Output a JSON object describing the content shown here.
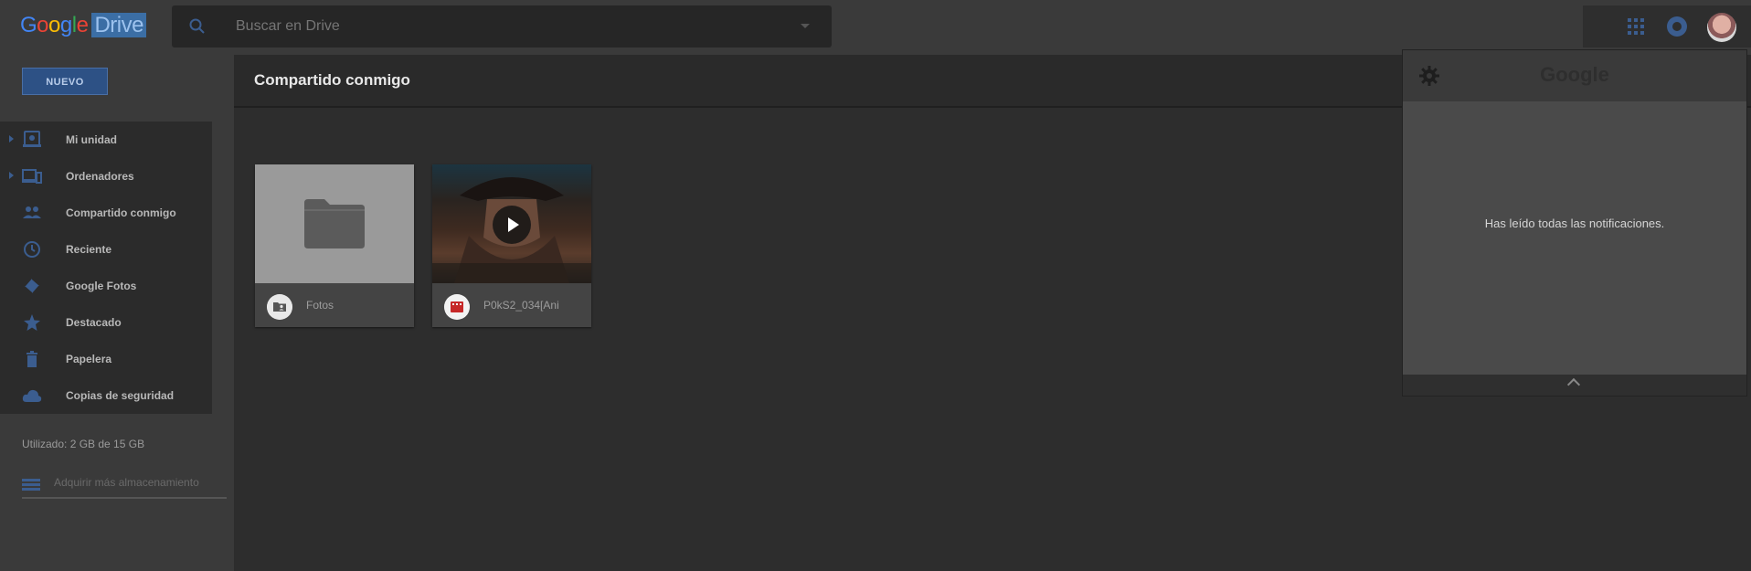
{
  "header": {
    "logo_google": [
      "G",
      "o",
      "o",
      "g",
      "l",
      "e"
    ],
    "logo_product": "Drive",
    "search_placeholder": "Buscar en Drive"
  },
  "sidebar": {
    "new_button": "NUEVO",
    "items": [
      {
        "label": "Mi unidad",
        "icon": "drive-icon",
        "expandable": true
      },
      {
        "label": "Ordenadores",
        "icon": "computers-icon",
        "expandable": true
      },
      {
        "label": "Compartido conmigo",
        "icon": "shared-icon",
        "expandable": false
      },
      {
        "label": "Reciente",
        "icon": "clock-icon",
        "expandable": false
      },
      {
        "label": "Google Fotos",
        "icon": "photos-icon",
        "expandable": false
      },
      {
        "label": "Destacado",
        "icon": "star-icon",
        "expandable": false
      },
      {
        "label": "Papelera",
        "icon": "trash-icon",
        "expandable": false
      },
      {
        "label": "Copias de seguridad",
        "icon": "cloud-icon",
        "expandable": false
      }
    ],
    "storage": "Utilizado: 2 GB de 15 GB",
    "buy_storage": "Adquirir más almacenamiento"
  },
  "main": {
    "title": "Compartido conmigo",
    "files": [
      {
        "name": "Fotos",
        "type": "shared-folder"
      },
      {
        "name": "P0kS2_034[Ani",
        "type": "video"
      }
    ]
  },
  "notifications": {
    "brand": "Google",
    "message": "Has leído todas las notificaciones."
  },
  "colors": {
    "accent": "#3b5d8f",
    "background": "#2d2d2d",
    "sidebar": "#3a3a3a"
  }
}
